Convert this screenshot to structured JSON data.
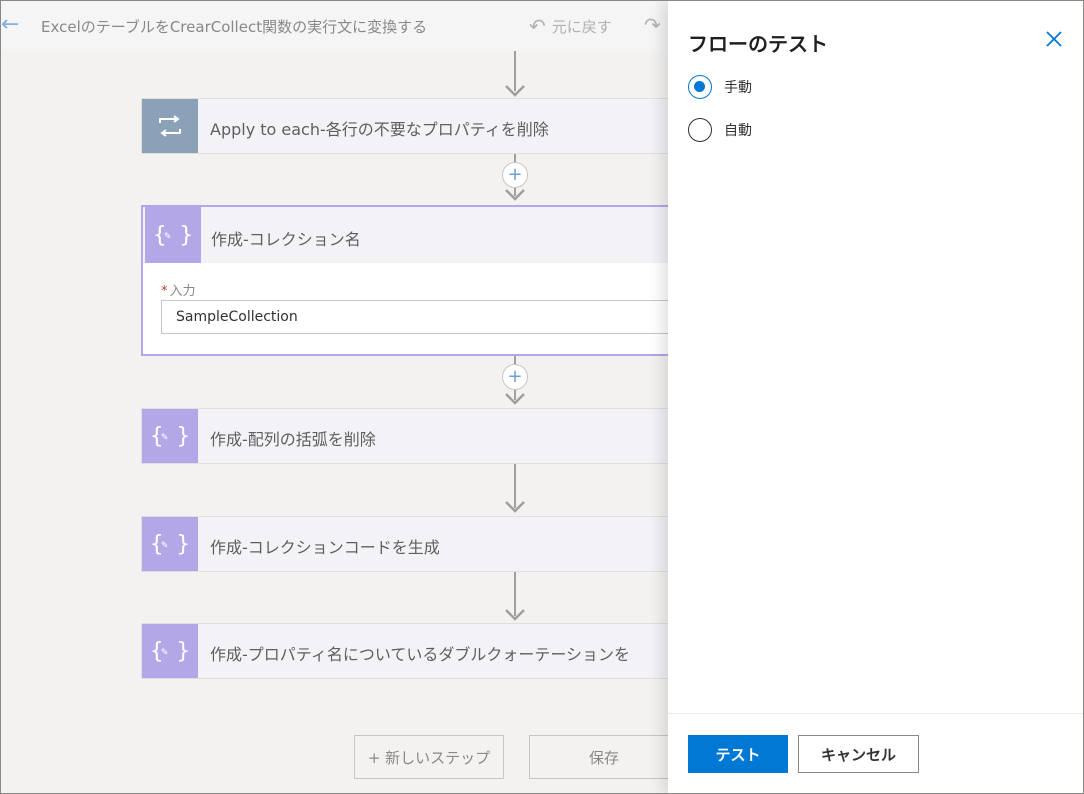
{
  "header": {
    "flow_title": "ExcelのテーブルをCrearCollect関数の実行文に変換する",
    "undo_label": "元に戻す"
  },
  "steps": [
    {
      "title": "Apply to each-各行の不要なプロパティを削除",
      "icon": "loop-icon"
    },
    {
      "title": "作成-コレクション名",
      "icon": "compose-icon",
      "field_label": "入力",
      "field_value": "SampleCollection"
    },
    {
      "title": "作成-配列の括弧を削除",
      "icon": "compose-icon"
    },
    {
      "title": "作成-コレクションコードを生成",
      "icon": "compose-icon"
    },
    {
      "title": "作成-プロパティ名についているダブルクォーテーションを",
      "icon": "compose-icon"
    }
  ],
  "bottom": {
    "new_step_label": "+ 新しいステップ",
    "save_label": "保存"
  },
  "panel": {
    "title": "フローのテスト",
    "options": [
      {
        "label": "手動",
        "selected": true
      },
      {
        "label": "自動",
        "selected": false
      }
    ],
    "test_label": "テスト",
    "cancel_label": "キャンセル"
  },
  "colors": {
    "primary": "#0078d4",
    "compose_accent": "#b4a7e8",
    "loop_accent": "#8aa1b8"
  }
}
